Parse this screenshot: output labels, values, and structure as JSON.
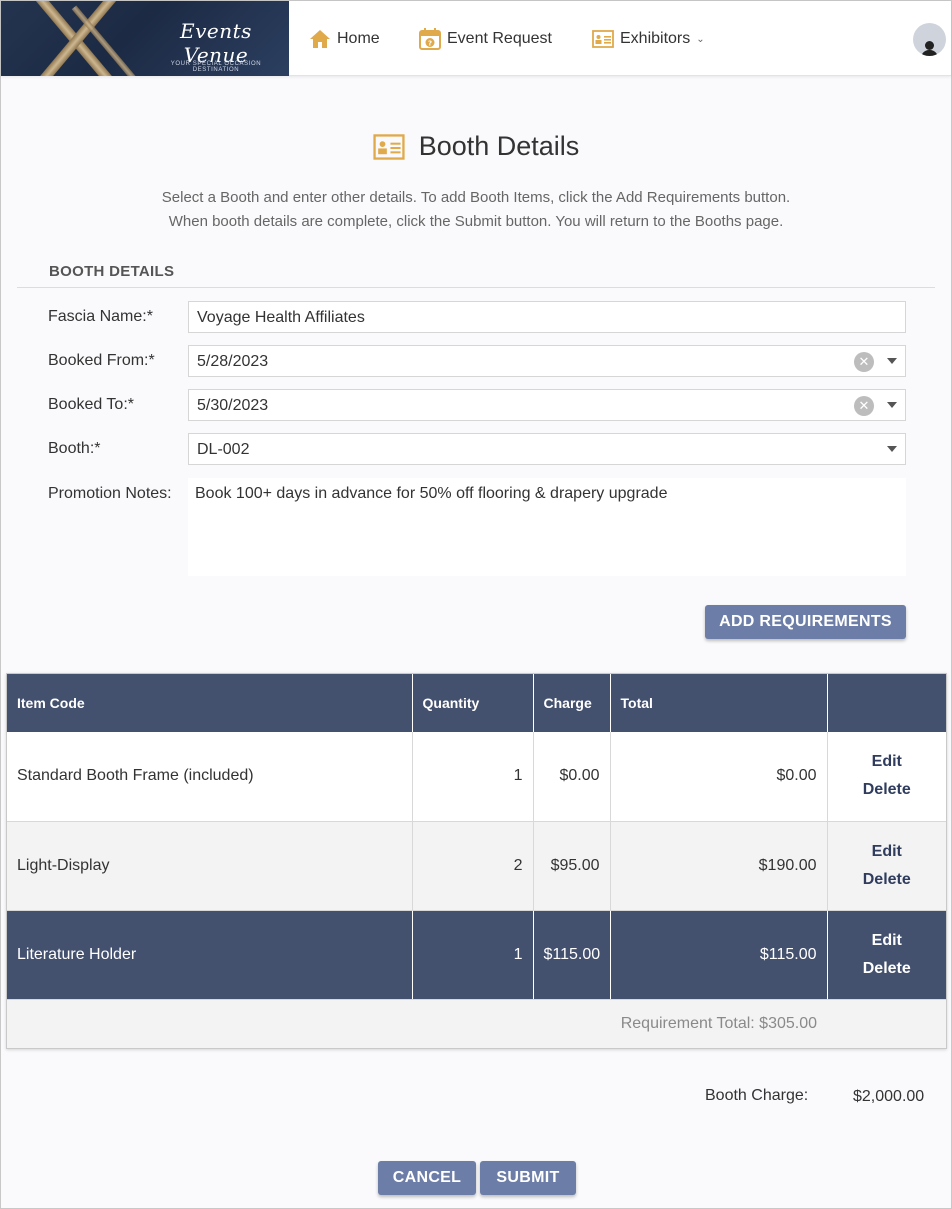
{
  "logo": {
    "script": "Events Venue",
    "tagline": "YOUR SPECIAL OCCASION DESTINATION"
  },
  "nav": {
    "home": "Home",
    "event_request": "Event Request",
    "exhibitors": "Exhibitors"
  },
  "page": {
    "title": "Booth Details",
    "intro_line1": "Select a Booth and enter other details. To add Booth Items, click the Add Requirements button.",
    "intro_line2": "When booth details are complete, click the Submit button. You will return to the Booths page.",
    "section": "BOOTH DETAILS"
  },
  "form": {
    "fascia_label": "Fascia Name:*",
    "fascia_value": "Voyage Health Affiliates",
    "from_label": "Booked From:*",
    "from_value": "5/28/2023",
    "to_label": "Booked To:*",
    "to_value": "5/30/2023",
    "booth_label": "Booth:*",
    "booth_value": "DL-002",
    "notes_label": "Promotion Notes:",
    "notes_value": "Book 100+ days in advance for 50% off flooring & drapery upgrade"
  },
  "buttons": {
    "add": "ADD REQUIREMENTS",
    "cancel": "CANCEL",
    "submit": "SUBMIT",
    "edit": "Edit",
    "delete": "Delete"
  },
  "grid": {
    "columns": [
      "Item Code",
      "Quantity",
      "Charge",
      "Total",
      ""
    ],
    "rows": [
      {
        "item": "Standard Booth Frame (included)",
        "qty": "1",
        "charge": "$0.00",
        "total": "$0.00"
      },
      {
        "item": "Light-Display",
        "qty": "2",
        "charge": "$95.00",
        "total": "$190.00"
      },
      {
        "item": "Literature Holder",
        "qty": "1",
        "charge": "$115.00",
        "total": "$115.00"
      }
    ],
    "footer": "Requirement Total: $305.00"
  },
  "summary": {
    "booth_charge_label": "Booth Charge:",
    "booth_charge_value": "$2,000.00"
  },
  "colors": {
    "accent": "#6c7ea7",
    "header": "#43506e",
    "icon": "#e0a94a"
  }
}
